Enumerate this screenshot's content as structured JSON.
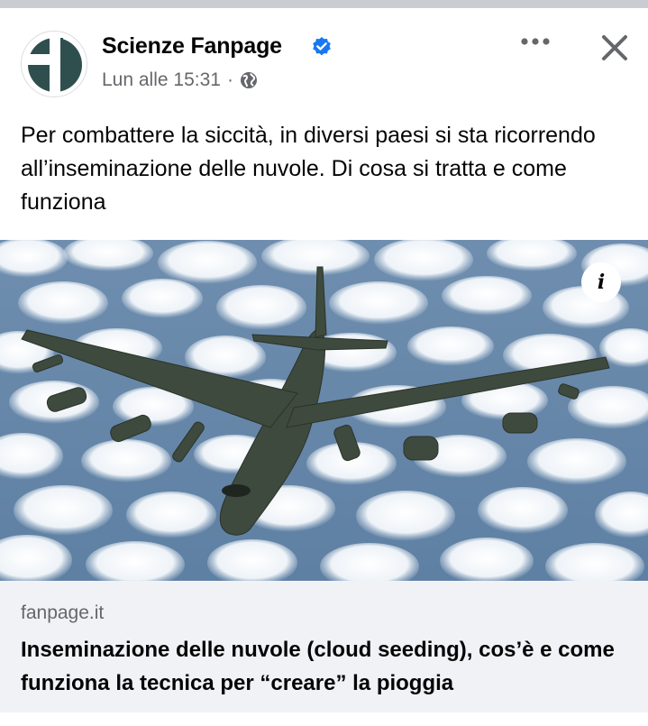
{
  "post": {
    "page_name": "Scienze Fanpage",
    "timestamp": "Lun alle 15:31",
    "separator": "·",
    "verified": true,
    "privacy_icon": "globe-icon",
    "text": "Per combattere la siccità, in diversi paesi si sta ricorrendo all’inseminazione delle nuvole. Di cosa si tratta e come funziona"
  },
  "actions": {
    "more_icon": "more-horizontal-icon",
    "close_icon": "close-icon"
  },
  "media": {
    "info_label": "i",
    "description_icon": "airplane-over-clouds-image"
  },
  "link_preview": {
    "domain": "fanpage.it",
    "title": "Inseminazione delle nuvole (cloud seeding), cos’è e come funziona la tecnica per “creare” la pioggia"
  },
  "colors": {
    "verified_blue": "#1877f2",
    "secondary_text": "#65676b",
    "card_bg": "#f0f2f5",
    "brand_dark": "#2f4f4f",
    "sky_blue": "#6d8fb0"
  }
}
